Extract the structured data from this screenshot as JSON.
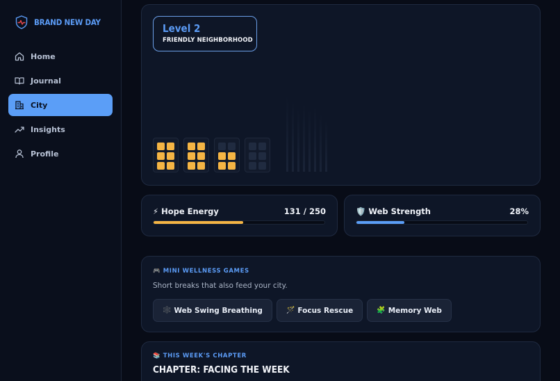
{
  "brand": {
    "name": "BRAND NEW DAY",
    "icon": "heartbeat-shield-icon"
  },
  "nav": [
    {
      "label": "Home",
      "icon": "home-icon",
      "active": false
    },
    {
      "label": "Journal",
      "icon": "book-icon",
      "active": false
    },
    {
      "label": "City",
      "icon": "buildings-icon",
      "active": true
    },
    {
      "label": "Insights",
      "icon": "trending-up-icon",
      "active": false
    },
    {
      "label": "Profile",
      "icon": "user-icon",
      "active": false
    }
  ],
  "city": {
    "level_title": "Level 2",
    "level_subtitle": "FRIENDLY NEIGHBORHOOD",
    "buildings": [
      {
        "lit_windows": 6,
        "total_windows": 6
      },
      {
        "lit_windows": 6,
        "total_windows": 6
      },
      {
        "lit_windows": 4,
        "total_windows": 6
      },
      {
        "lit_windows": 0,
        "total_windows": 6
      }
    ]
  },
  "stats": {
    "hope": {
      "label": "⚡ Hope Energy",
      "value": "131 / 250",
      "fraction": 0.524,
      "color": "#f5b544"
    },
    "web": {
      "label": "🛡️ Web Strength",
      "value": "28%",
      "fraction": 0.28,
      "color": "#5b9ef7"
    }
  },
  "games": {
    "label": "🎮 MINI WELLNESS GAMES",
    "description": "Short breaks that also feed your city.",
    "items": [
      {
        "icon": "🕸️",
        "label": "Web Swing Breathing"
      },
      {
        "icon": "🪄",
        "label": "Focus Rescue"
      },
      {
        "icon": "🧩",
        "label": "Memory Web"
      }
    ]
  },
  "chapter": {
    "label": "📚 THIS WEEK'S CHAPTER",
    "title": "CHAPTER: FACING THE WEEK"
  },
  "colors": {
    "accent": "#5b9ef7",
    "energy": "#f5b544",
    "background": "#080c17"
  }
}
